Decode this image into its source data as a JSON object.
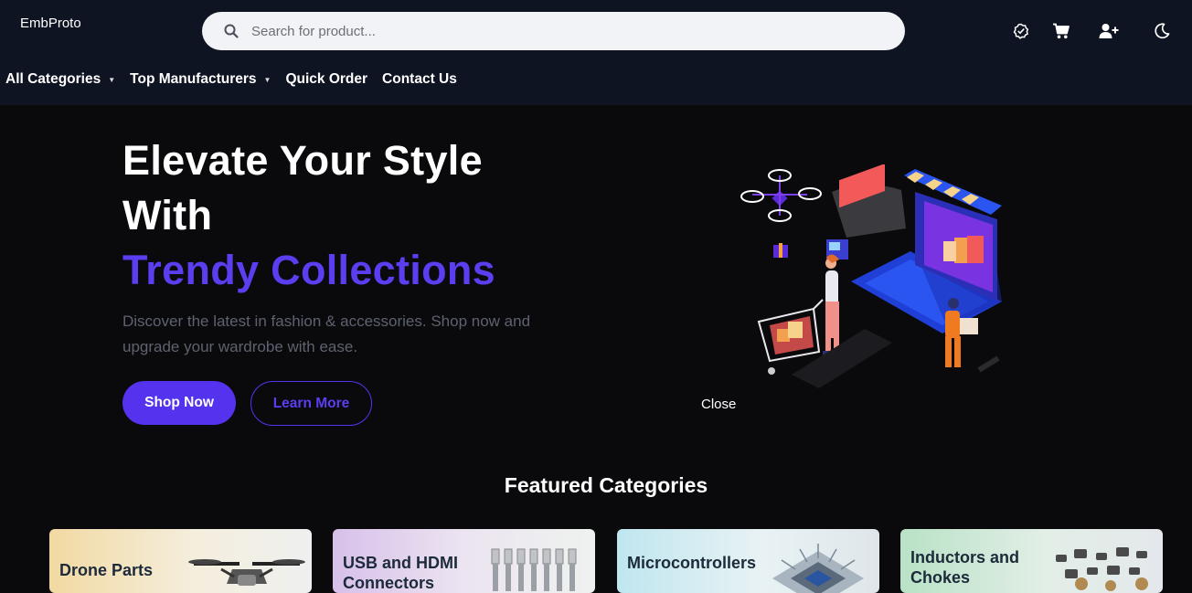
{
  "header": {
    "logo": "EmbProto",
    "search_placeholder": "Search for product...",
    "icons": [
      "verified-badge-icon",
      "cart-icon",
      "add-user-icon",
      "moon-icon"
    ]
  },
  "nav": {
    "items": [
      {
        "label": "All Categories",
        "dropdown": true
      },
      {
        "label": "Top Manufacturers",
        "dropdown": true
      },
      {
        "label": "Quick Order",
        "dropdown": false
      },
      {
        "label": "Contact Us",
        "dropdown": false
      }
    ]
  },
  "hero": {
    "title_line1": "Elevate Your Style",
    "title_line2": "With",
    "title_accent": "Trendy Collections",
    "subtitle": "Discover the latest in fashion & accessories. Shop now and upgrade your wardrobe with ease.",
    "primary_button": "Shop Now",
    "secondary_button": "Learn More",
    "close_label": "Close"
  },
  "featured": {
    "title": "Featured Categories",
    "cards": [
      {
        "label": "Drone Parts"
      },
      {
        "label": "USB and HDMI Connectors"
      },
      {
        "label": "Microcontrollers"
      },
      {
        "label": "Inductors and Chokes"
      }
    ]
  },
  "colors": {
    "header_bg": "#0f1423",
    "page_bg": "#0a0a0c",
    "accent": "#5533ee"
  }
}
